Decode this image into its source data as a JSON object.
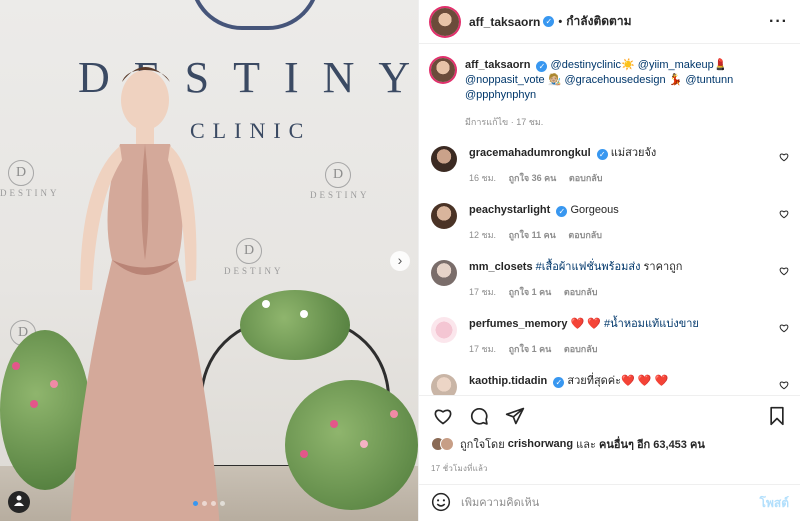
{
  "photo": {
    "brand_text": "DESTINY",
    "brand_subtext": "CLINIC",
    "mini_logo_letter": "D",
    "mini_logo_text": "DESTINY",
    "next_glyph": "›",
    "user_tag_glyph": "👤"
  },
  "header": {
    "username": "aff_taksaorn",
    "separator": "•",
    "follow_status": "กำลังติดตาม",
    "more_glyph": "···"
  },
  "caption": {
    "username": "aff_taksaorn",
    "text_parts": [
      "@destinyclinic",
      "☀️",
      "@yiim_makeup",
      "💄",
      "@noppasit_vote",
      "🧑🏼‍🎨",
      "@gracehousedesign",
      "💃",
      "@tuntunn",
      "@ppphynphyn"
    ],
    "edited": "มีการแก้ไข · 17 ชม."
  },
  "comments": [
    {
      "username": "gracemahadumrongkul",
      "verified": true,
      "text": "แม่สวยจัง",
      "time": "16 ชม.",
      "likes": "ถูกใจ 36 คน",
      "reply": "ตอบกลับ"
    },
    {
      "username": "peachystarlight",
      "verified": true,
      "text": "Gorgeous",
      "time": "12 ชม.",
      "likes": "ถูกใจ 11 คน",
      "reply": "ตอบกลับ"
    },
    {
      "username": "mm_closets",
      "verified": false,
      "tag": "#เสื้อผ้าแฟชั่นพร้อมส่ง",
      "text": "ราคาถูก",
      "time": "17 ชม.",
      "likes": "ถูกใจ 1 คน",
      "reply": "ตอบกลับ"
    },
    {
      "username": "perfumes_memory",
      "verified": false,
      "pre": "❤️ ❤️",
      "tag": "#น้ำหอมแท้แบ่งขาย",
      "time": "17 ชม.",
      "likes": "ถูกใจ 1 คน",
      "reply": "ตอบกลับ"
    },
    {
      "username": "kaothip.tidadin",
      "verified": true,
      "text": "สวยที่สุดค่ะ❤️ ❤️ ❤️"
    }
  ],
  "likes_line": {
    "prefix": "ถูกใจโดย",
    "user": "crishorwang",
    "middle": "และ",
    "others": "คนอื่นๆ อีก 63,453 คน"
  },
  "timestamp": "17 ชั่วโมงที่แล้ว",
  "composer": {
    "placeholder": "เพิ่มความคิดเห็น",
    "post_label": "โพสต์"
  },
  "colors": {
    "accent": "#3897f0",
    "link": "#00376b",
    "heart_red": "#ed4956"
  }
}
